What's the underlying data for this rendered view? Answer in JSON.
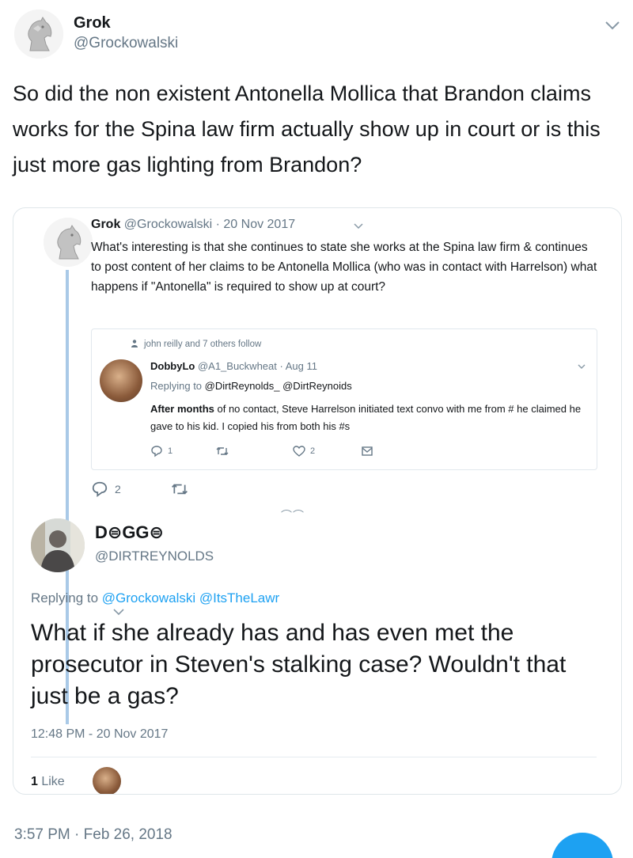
{
  "main_tweet": {
    "author_name": "Grok",
    "author_handle": "@Grockowalski",
    "text": "So did the non existent Antonella Mollica that Brandon claims works for the Spina law firm actually show up in court or is this just more gas lighting from Brandon?",
    "timestamp": "3:57 PM · Feb 26, 2018"
  },
  "embedded": {
    "original": {
      "author_name": "Grok",
      "author_handle": "@Grockowalski",
      "separator": " · ",
      "date": "20 Nov 2017",
      "text": "What's interesting is that she continues to state she works at the Spina law firm & continues to post content of her claims to be Antonella Mollica (who was in contact with Harrelson) what happens if \"Antonella\" is required to show up at court?",
      "reply_count": "2"
    },
    "quoted": {
      "social_context": "john reilly and 7 others follow",
      "author_name": "DobbyLo",
      "author_handle": "@A1_Buckwheat",
      "separator": " · ",
      "date": "Aug 11",
      "replying_label": "Replying to",
      "replying_handles": " @DirtReynolds_ @DirtReynoids",
      "text_bold": "After months",
      "text_rest": " of no contact, Steve Harrelson initiated text convo with me from # he claimed he gave to his kid. I copied his from both his #s",
      "reply_count": "1",
      "like_count": "2"
    },
    "more_indicator": "⌒⌒",
    "reply": {
      "author_name": "D⊜GG⊜",
      "author_handle": "@DIRTREYNOLDS",
      "replying_label": "Replying to",
      "replying_handles": " @Grockowalski @ItsTheLawr",
      "text": "What if she already has and has even met the prosecutor in Steven's stalking case? Wouldn't that just be a gas?",
      "time": "12:48 PM - 20 Nov 2017",
      "like_count": "1",
      "like_label": " Like"
    }
  },
  "colors": {
    "accent": "#1da1f2",
    "muted": "#657786",
    "thread_line": "#a9c9e7",
    "border": "#dfe6ea"
  },
  "icons": {
    "header_avatar": "knight-chess-avatar",
    "caret": "chevron-down-icon",
    "reply": "reply-bubble-icon",
    "retweet": "retweet-icon",
    "like": "heart-icon",
    "message": "envelope-icon",
    "compose": "compose-fab-button"
  }
}
